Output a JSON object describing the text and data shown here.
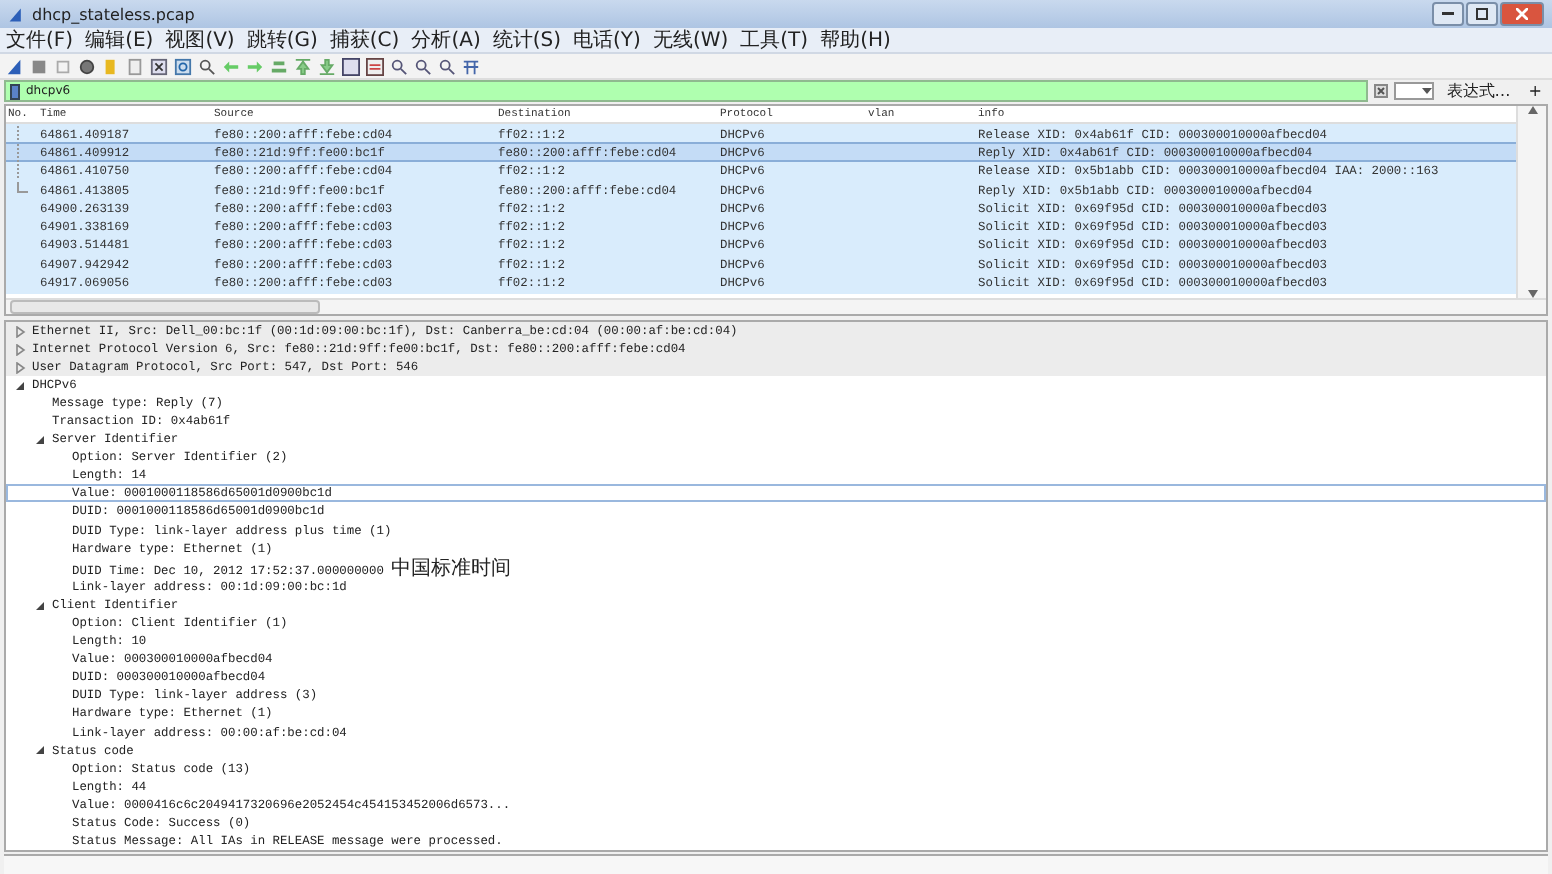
{
  "window": {
    "title": "dhcp_stateless.pcap"
  },
  "menu": [
    "文件(F)",
    "编辑(E)",
    "视图(V)",
    "跳转(G)",
    "捕获(C)",
    "分析(A)",
    "统计(S)",
    "电话(Y)",
    "无线(W)",
    "工具(T)",
    "帮助(H)"
  ],
  "filter": {
    "value": "dhcpv6",
    "expression_button": "表达式…",
    "add_button": "+"
  },
  "packet_list": {
    "columns": [
      "No.",
      "Time",
      "Source",
      "Destination",
      "Protocol",
      "vlan",
      "info"
    ],
    "rows": [
      {
        "time": "64861.409187",
        "source": "fe80::200:afff:febe:cd04",
        "destination": "ff02::1:2",
        "protocol": "DHCPv6",
        "info": "Release XID: 0x4ab61f CID: 000300010000afbecd04",
        "related": true,
        "selected": false
      },
      {
        "time": "64861.409912",
        "source": "fe80::21d:9ff:fe00:bc1f",
        "destination": "fe80::200:afff:febe:cd04",
        "protocol": "DHCPv6",
        "info": "Reply XID: 0x4ab61f CID: 000300010000afbecd04",
        "related": true,
        "selected": true
      },
      {
        "time": "64861.410750",
        "source": "fe80::200:afff:febe:cd04",
        "destination": "ff02::1:2",
        "protocol": "DHCPv6",
        "info": "Release XID: 0x5b1abb CID: 000300010000afbecd04 IAA: 2000::163",
        "related": true,
        "selected": false
      },
      {
        "time": "64861.413805",
        "source": "fe80::21d:9ff:fe00:bc1f",
        "destination": "fe80::200:afff:febe:cd04",
        "protocol": "DHCPv6",
        "info": "Reply XID: 0x5b1abb CID: 000300010000afbecd04",
        "related": true,
        "selected": false
      },
      {
        "time": "64900.263139",
        "source": "fe80::200:afff:febe:cd03",
        "destination": "ff02::1:2",
        "protocol": "DHCPv6",
        "info": "Solicit XID: 0x69f95d CID: 000300010000afbecd03",
        "related": false,
        "selected": false
      },
      {
        "time": "64901.338169",
        "source": "fe80::200:afff:febe:cd03",
        "destination": "ff02::1:2",
        "protocol": "DHCPv6",
        "info": "Solicit XID: 0x69f95d CID: 000300010000afbecd03",
        "related": false,
        "selected": false
      },
      {
        "time": "64903.514481",
        "source": "fe80::200:afff:febe:cd03",
        "destination": "ff02::1:2",
        "protocol": "DHCPv6",
        "info": "Solicit XID: 0x69f95d CID: 000300010000afbecd03",
        "related": false,
        "selected": false
      },
      {
        "time": "64907.942942",
        "source": "fe80::200:afff:febe:cd03",
        "destination": "ff02::1:2",
        "protocol": "DHCPv6",
        "info": "Solicit XID: 0x69f95d CID: 000300010000afbecd03",
        "related": false,
        "selected": false
      },
      {
        "time": "64917.069056",
        "source": "fe80::200:afff:febe:cd03",
        "destination": "ff02::1:2",
        "protocol": "DHCPv6",
        "info": "Solicit XID: 0x69f95d CID: 000300010000afbecd03",
        "related": false,
        "selected": false
      }
    ]
  },
  "details": [
    {
      "text": "Ethernet II, Src: Dell_00:bc:1f (00:1d:09:00:bc:1f), Dst: Canberra_be:cd:04 (00:00:af:be:cd:04)",
      "expanded": false,
      "selected": false
    },
    {
      "text": "Internet Protocol Version 6, Src: fe80::21d:9ff:fe00:bc1f, Dst: fe80::200:afff:febe:cd04",
      "expanded": false,
      "selected": false
    },
    {
      "text": "User Datagram Protocol, Src Port: 547, Dst Port: 546",
      "expanded": false,
      "selected": false
    },
    {
      "text": "DHCPv6",
      "expanded": true,
      "selected": false,
      "children": [
        {
          "text": "Message type: Reply (7)",
          "selected": false
        },
        {
          "text": "Transaction ID: 0x4ab61f",
          "selected": false
        },
        {
          "text": "Server Identifier",
          "expanded": true,
          "selected": false,
          "children": [
            {
              "text": "Option: Server Identifier (2)",
              "selected": false
            },
            {
              "text": "Length: 14",
              "selected": false
            },
            {
              "text": "Value: 0001000118586d65001d0900bc1d",
              "selected": true
            },
            {
              "text": "DUID: 0001000118586d65001d0900bc1d",
              "selected": false
            },
            {
              "text": "DUID Type: link-layer address plus time (1)",
              "selected": false
            },
            {
              "text": "Hardware type: Ethernet (1)",
              "selected": false
            },
            {
              "text": "DUID Time: Dec 10, 2012 17:52:37.000000000 中国标准时间",
              "selected": false
            },
            {
              "text": "Link-layer address: 00:1d:09:00:bc:1d",
              "selected": false
            }
          ]
        },
        {
          "text": "Client Identifier",
          "expanded": true,
          "selected": false,
          "children": [
            {
              "text": "Option: Client Identifier (1)",
              "selected": false
            },
            {
              "text": "Length: 10",
              "selected": false
            },
            {
              "text": "Value: 000300010000afbecd04",
              "selected": false
            },
            {
              "text": "DUID: 000300010000afbecd04",
              "selected": false
            },
            {
              "text": "DUID Type: link-layer address (3)",
              "selected": false
            },
            {
              "text": "Hardware type: Ethernet (1)",
              "selected": false
            },
            {
              "text": "Link-layer address: 00:00:af:be:cd:04",
              "selected": false
            }
          ]
        },
        {
          "text": "Status code",
          "expanded": true,
          "selected": false,
          "children": [
            {
              "text": "Option: Status code (13)",
              "selected": false
            },
            {
              "text": "Length: 44",
              "selected": false
            },
            {
              "text": "Value: 0000416c6c2049417320696e2052454c454153452006d6573...",
              "selected": false
            },
            {
              "text": "Status Code: Success (0)",
              "selected": false
            },
            {
              "text": "Status Message: All IAs in RELEASE message were processed.",
              "selected": false
            }
          ]
        }
      ]
    }
  ]
}
